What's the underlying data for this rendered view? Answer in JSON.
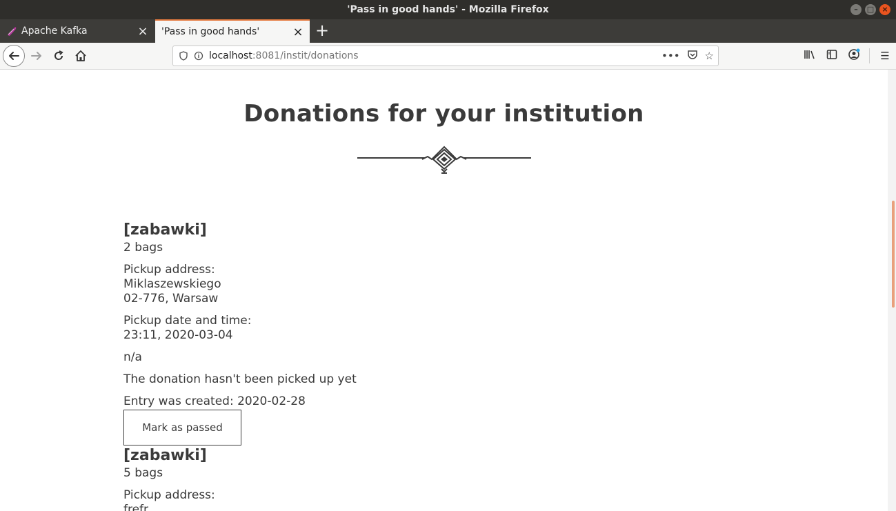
{
  "window": {
    "title": "'Pass in good hands' - Mozilla Firefox"
  },
  "tabs": [
    {
      "label": "Apache Kafka",
      "active": false
    },
    {
      "label": "'Pass in good hands'",
      "active": true
    }
  ],
  "urlbar": {
    "host": "localhost",
    "rest": ":8081/instit/donations"
  },
  "colors": {
    "active_tab_accent": "#e57a3e",
    "titlebar": "#2f2e2b",
    "text": "#3a3a3a"
  },
  "page": {
    "title": "Donations for your institution"
  },
  "donations": [
    {
      "category": "[zabawki]",
      "bags": "2 bags",
      "address_label": "Pickup address:",
      "street": "Miklaszewskiego",
      "city": "02-776, Warsaw",
      "date_label": "Pickup date and time:",
      "date": "23:11, 2020-03-04",
      "comment": "n/a",
      "status": "The donation hasn't been picked up yet",
      "created": "Entry was created: 2020-02-28",
      "button": "Mark as passed"
    },
    {
      "category": "[zabawki]",
      "bags": "5 bags",
      "address_label": "Pickup address:",
      "street": "frefr"
    }
  ]
}
